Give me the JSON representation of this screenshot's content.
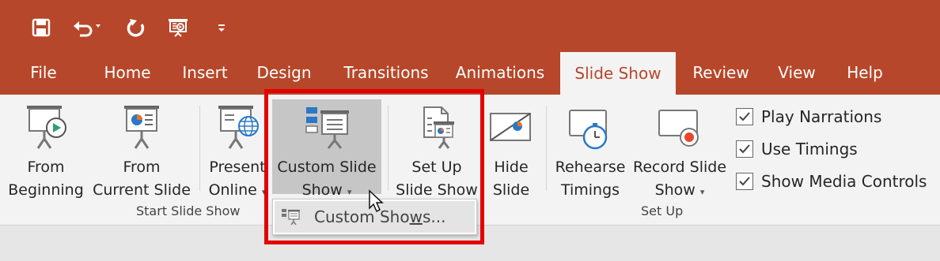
{
  "colors": {
    "accent": "#b7472a",
    "highlight": "#e30000",
    "ribbon_bg": "#f3f3f3"
  },
  "quick_access": [
    {
      "name": "save-icon"
    },
    {
      "name": "undo-icon"
    },
    {
      "name": "redo-icon"
    },
    {
      "name": "start-from-beginning-icon"
    },
    {
      "name": "customize-qat-icon"
    }
  ],
  "tabs": [
    "File",
    "Home",
    "Insert",
    "Design",
    "Transitions",
    "Animations",
    "Slide Show",
    "Review",
    "View",
    "Help"
  ],
  "active_tab": "Slide Show",
  "ribbon": {
    "from_beginning": {
      "line1": "From",
      "line2": "Beginning"
    },
    "from_current": {
      "line1": "From",
      "line2": "Current Slide"
    },
    "present_online": {
      "line1": "Present",
      "line2": "Online"
    },
    "custom_slide_show": {
      "line1": "Custom Slide",
      "line2": "Show"
    },
    "set_up": {
      "line1": "Set Up",
      "line2": "Slide Show"
    },
    "hide_slide": {
      "line1": "Hide",
      "line2": "Slide"
    },
    "rehearse": {
      "line1": "Rehearse",
      "line2": "Timings"
    },
    "record": {
      "line1": "Record Slide",
      "line2": "Show"
    },
    "groups": {
      "start": "Start Slide Show",
      "setup": "Set Up"
    },
    "checkboxes": [
      {
        "label": "Play Narrations",
        "checked": true
      },
      {
        "label": "Use Timings",
        "checked": true
      },
      {
        "label": "Show Media Controls",
        "checked": true
      }
    ]
  },
  "dropdown": {
    "item_prefix": "Custom Sho",
    "item_underlined": "w",
    "item_suffix": "s..."
  }
}
